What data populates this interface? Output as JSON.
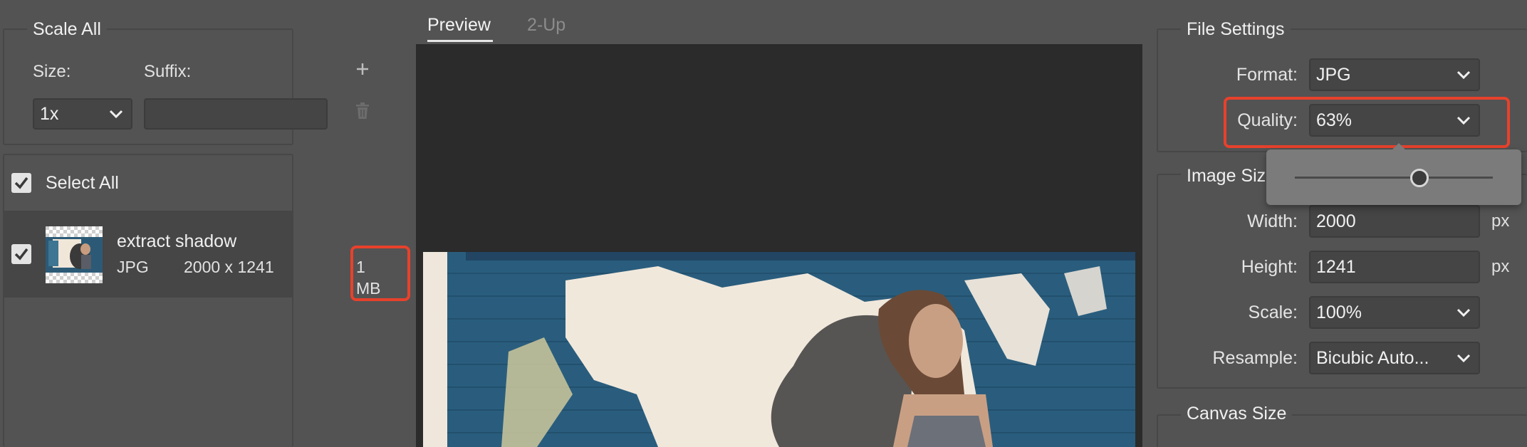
{
  "scale_all": {
    "title": "Scale All",
    "size_label": "Size:",
    "suffix_label": "Suffix:",
    "size_value": "1x",
    "suffix_value": "",
    "add_icon": "plus-icon",
    "delete_icon": "trash-icon"
  },
  "assets": {
    "select_all_label": "Select All",
    "select_all_checked": true,
    "items": [
      {
        "name": "extract shadow",
        "format": "JPG",
        "dimensions": "2000 x 1241",
        "size": "1 MB",
        "checked": true
      }
    ]
  },
  "preview": {
    "tabs": [
      {
        "label": "Preview",
        "active": true
      },
      {
        "label": "2-Up",
        "active": false
      }
    ]
  },
  "file_settings": {
    "title": "File Settings",
    "format_label": "Format:",
    "format_value": "JPG",
    "quality_label": "Quality:",
    "quality_value": "63%",
    "quality_slider_fraction": 0.63
  },
  "image_size": {
    "title": "Image Size",
    "width_label": "Width:",
    "width_value": "2000",
    "height_label": "Height:",
    "height_value": "1241",
    "scale_label": "Scale:",
    "scale_value": "100%",
    "resample_label": "Resample:",
    "resample_value": "Bicubic Auto...",
    "unit": "px"
  },
  "canvas_size": {
    "title": "Canvas Size"
  },
  "colors": {
    "highlight": "#e8412c",
    "panel_bg": "#535353",
    "preview_bg": "#2b2b2b"
  }
}
